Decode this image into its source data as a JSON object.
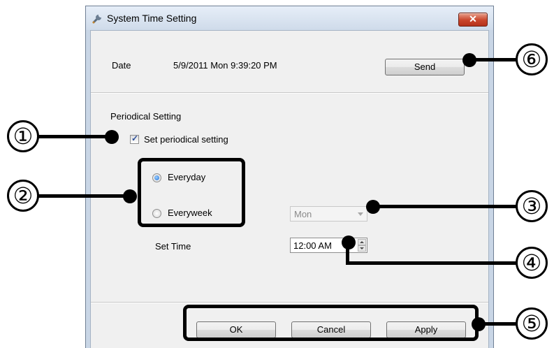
{
  "window": {
    "title": "System Time Setting",
    "close_glyph": "✕"
  },
  "date": {
    "label": "Date",
    "value": "5/9/2011 Mon 9:39:20 PM"
  },
  "send_button": "Send",
  "periodical": {
    "section_label": "Periodical Setting",
    "checkbox_label": "Set periodical setting",
    "checkbox_checked": true,
    "radio_everyday": "Everyday",
    "radio_everyweek": "Everyweek",
    "selected_radio": "Everyday",
    "weekday_value": "Mon",
    "set_time_label": "Set Time",
    "time_value": "12:00 AM"
  },
  "footer": {
    "ok": "OK",
    "cancel": "Cancel",
    "apply": "Apply"
  },
  "callouts": [
    "1",
    "2",
    "3",
    "4",
    "5",
    "6"
  ],
  "callout_glyphs": [
    "①",
    "②",
    "③",
    "④",
    "⑤",
    "⑥"
  ],
  "icons": {
    "title": "wrench-icon",
    "close": "close-icon"
  },
  "colors": {
    "close_red": "#c9452b",
    "radio_blue": "#1c6ed4",
    "check_blue": "#2b4f9b"
  }
}
